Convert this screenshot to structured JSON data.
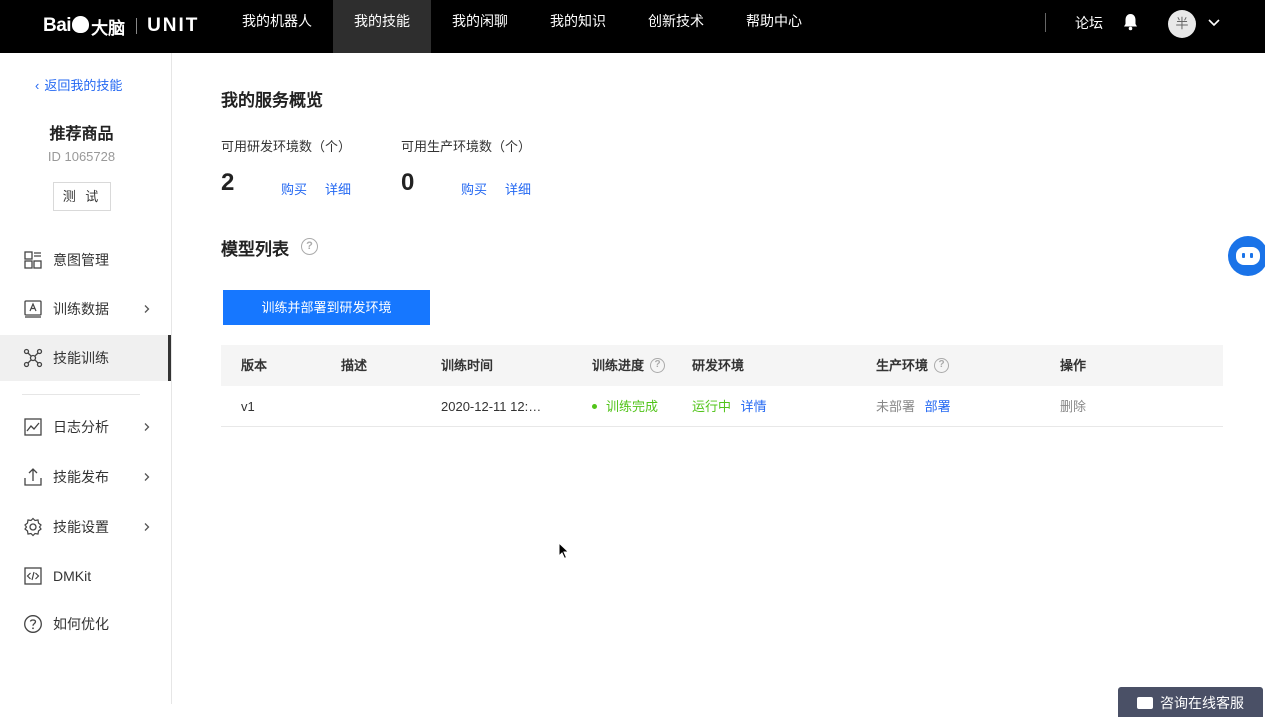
{
  "brand": {
    "logo_text": "Bai",
    "logo_suffix": "大脑",
    "product": "UNIT"
  },
  "nav": {
    "items": [
      {
        "label": "我的机器人",
        "active": false
      },
      {
        "label": "我的技能",
        "active": true
      },
      {
        "label": "我的闲聊",
        "active": false
      },
      {
        "label": "我的知识",
        "active": false
      },
      {
        "label": "创新技术",
        "active": false
      },
      {
        "label": "帮助中心",
        "active": false
      }
    ],
    "forum": "论坛",
    "avatar_text": "半"
  },
  "sidebar": {
    "back_label": "返回我的技能",
    "skill_name": "推荐商品",
    "skill_id": "ID 1065728",
    "test_label": "测 试",
    "items": [
      {
        "label": "意图管理",
        "icon": "intent-grid-icon",
        "has_arrow": false,
        "active": false
      },
      {
        "label": "训练数据",
        "icon": "training-data-icon",
        "has_arrow": true,
        "active": false
      },
      {
        "label": "技能训练",
        "icon": "network-nodes-icon",
        "has_arrow": false,
        "active": true
      },
      {
        "label": "日志分析",
        "icon": "chart-trend-icon",
        "has_arrow": true,
        "active": false
      },
      {
        "label": "技能发布",
        "icon": "upload-icon",
        "has_arrow": true,
        "active": false
      },
      {
        "label": "技能设置",
        "icon": "gear-icon",
        "has_arrow": true,
        "active": false
      },
      {
        "label": "DMKit",
        "icon": "code-icon",
        "has_arrow": false,
        "active": false
      },
      {
        "label": "如何优化",
        "icon": "question-icon",
        "has_arrow": false,
        "active": false
      }
    ]
  },
  "overview": {
    "title": "我的服务概览",
    "dev_env": {
      "label": "可用研发环境数（个）",
      "count": "2",
      "buy": "购买",
      "detail": "详细"
    },
    "prod_env": {
      "label": "可用生产环境数（个）",
      "count": "0",
      "buy": "购买",
      "detail": "详细"
    }
  },
  "models": {
    "title": "模型列表",
    "train_button": "训练并部署到研发环境",
    "columns": [
      "版本",
      "描述",
      "训练时间",
      "训练进度",
      "研发环境",
      "生产环境",
      "操作"
    ],
    "rows": [
      {
        "version": "v1",
        "description": "",
        "train_time": "2020-12-11 12:…",
        "progress": "训练完成",
        "dev_status": "运行中",
        "dev_detail": "详情",
        "prod_status": "未部署",
        "prod_action": "部署",
        "operation": "删除"
      }
    ]
  },
  "chat_widget": {
    "label": "咨询在线客服"
  },
  "colors": {
    "accent": "#1677ff",
    "link": "#2468f2",
    "success": "#52c41a",
    "topbar": "#000000"
  }
}
